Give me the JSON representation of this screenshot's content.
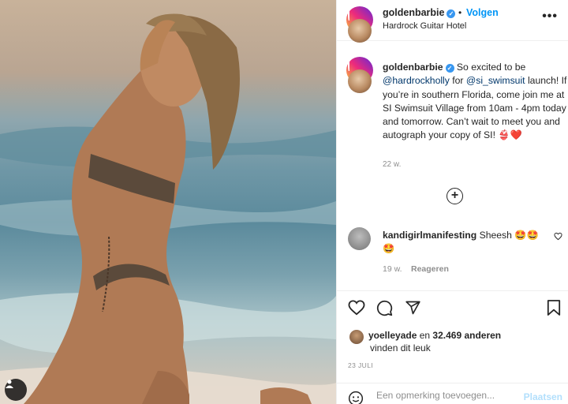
{
  "post": {
    "username": "goldenbarbie",
    "follow_label": "Volgen",
    "separator": "•",
    "location": "Hardrock Guitar Hotel",
    "more_label": "•••"
  },
  "caption": {
    "username": "goldenbarbie",
    "text_1": "So excited to be",
    "mention_1": "@hardrockholly",
    "text_2": "for",
    "mention_2": "@si_swimsuit",
    "text_3": "launch! If you’re in southern Florida, come join me at SI Swimsuit Village from 10am - 4pm today and tomorrow. Can’t wait to meet you and autograph your copy of SI!",
    "emoji": "👙❤️",
    "age": "22 w."
  },
  "load_more_label": "+",
  "comment": {
    "username": "kandigirlmanifesting",
    "text": "Sheesh",
    "emoji": "🤩🤩🤩",
    "age": "19 w.",
    "reply_label": "Reageren"
  },
  "likes": {
    "user": "yoelleyade",
    "middle": "en",
    "count": "32.469 anderen",
    "suffix": "vinden dit leuk"
  },
  "date": "23 JULI",
  "add_comment": {
    "placeholder": "Een opmerking toevoegen...",
    "post_label": "Plaatsen"
  },
  "colors": {
    "accent": "#0095f6",
    "link": "#00376b",
    "muted": "#8e8e8e",
    "post_disabled": "#b2dffc"
  },
  "icons": [
    "heart-icon",
    "comment-icon",
    "share-icon",
    "bookmark-icon",
    "emoji-icon",
    "user-tag-icon",
    "verified-icon",
    "more-icon",
    "plus-circle-icon"
  ]
}
